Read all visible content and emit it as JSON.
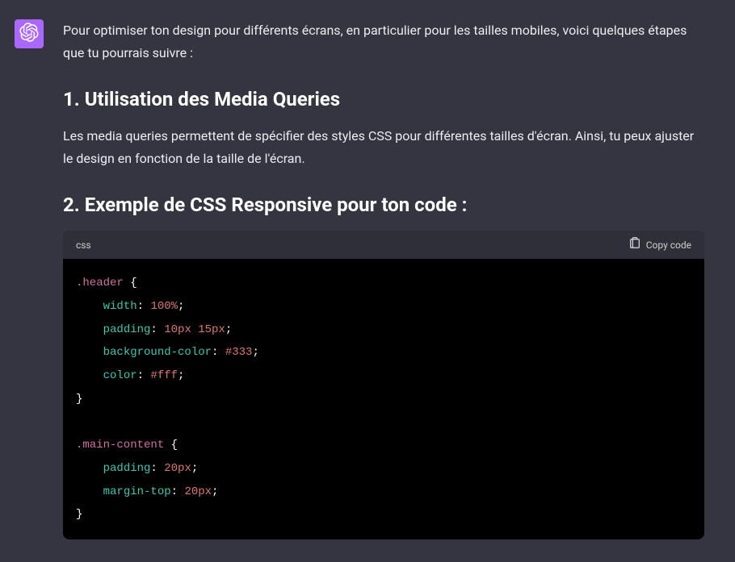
{
  "message": {
    "intro": "Pour optimiser ton design pour différents écrans, en particulier pour les tailles mobiles, voici quelques étapes que tu pourrais suivre :",
    "heading1": "1. Utilisation des Media Queries",
    "body1": "Les media queries permettent de spécifier des styles CSS pour différentes tailles d'écran. Ainsi, tu peux ajuster le design en fonction de la taille de l'écran.",
    "heading2": "2. Exemple de CSS Responsive pour ton code :"
  },
  "codeblock": {
    "language": "css",
    "copy_label": "Copy code",
    "lines": [
      {
        "type": "selector-open",
        "selector": ".header"
      },
      {
        "type": "decl",
        "prop": "width",
        "val": "100%",
        "valType": "num"
      },
      {
        "type": "decl",
        "prop": "padding",
        "val": "10px 15px",
        "valType": "num"
      },
      {
        "type": "decl",
        "prop": "background-color",
        "val": "#333",
        "valType": "hex"
      },
      {
        "type": "decl",
        "prop": "color",
        "val": "#fff",
        "valType": "hex"
      },
      {
        "type": "close"
      },
      {
        "type": "blank"
      },
      {
        "type": "selector-open",
        "selector": ".main-content"
      },
      {
        "type": "decl",
        "prop": "padding",
        "val": "20px",
        "valType": "num"
      },
      {
        "type": "decl",
        "prop": "margin-top",
        "val": "20px",
        "valType": "num"
      },
      {
        "type": "close"
      }
    ]
  }
}
